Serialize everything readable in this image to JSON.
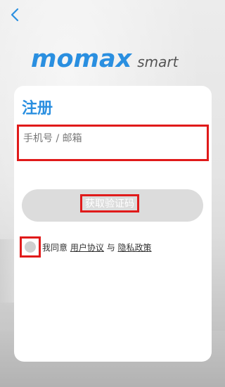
{
  "header": {
    "back_icon": "chevron-left-icon",
    "brand_main": "momax",
    "brand_sub": "smart"
  },
  "form": {
    "title": "注册",
    "phone_placeholder": "手机号 / 邮箱",
    "phone_value": "",
    "get_code_label": "获取验证码",
    "agree_prefix": "我同意",
    "user_agreement": "用户协议",
    "conjunction": "与",
    "privacy_policy": "隐私政策"
  },
  "colors": {
    "accent": "#2a8fe0",
    "highlight": "#e01a1a",
    "button_bg": "#dcdcdc"
  }
}
